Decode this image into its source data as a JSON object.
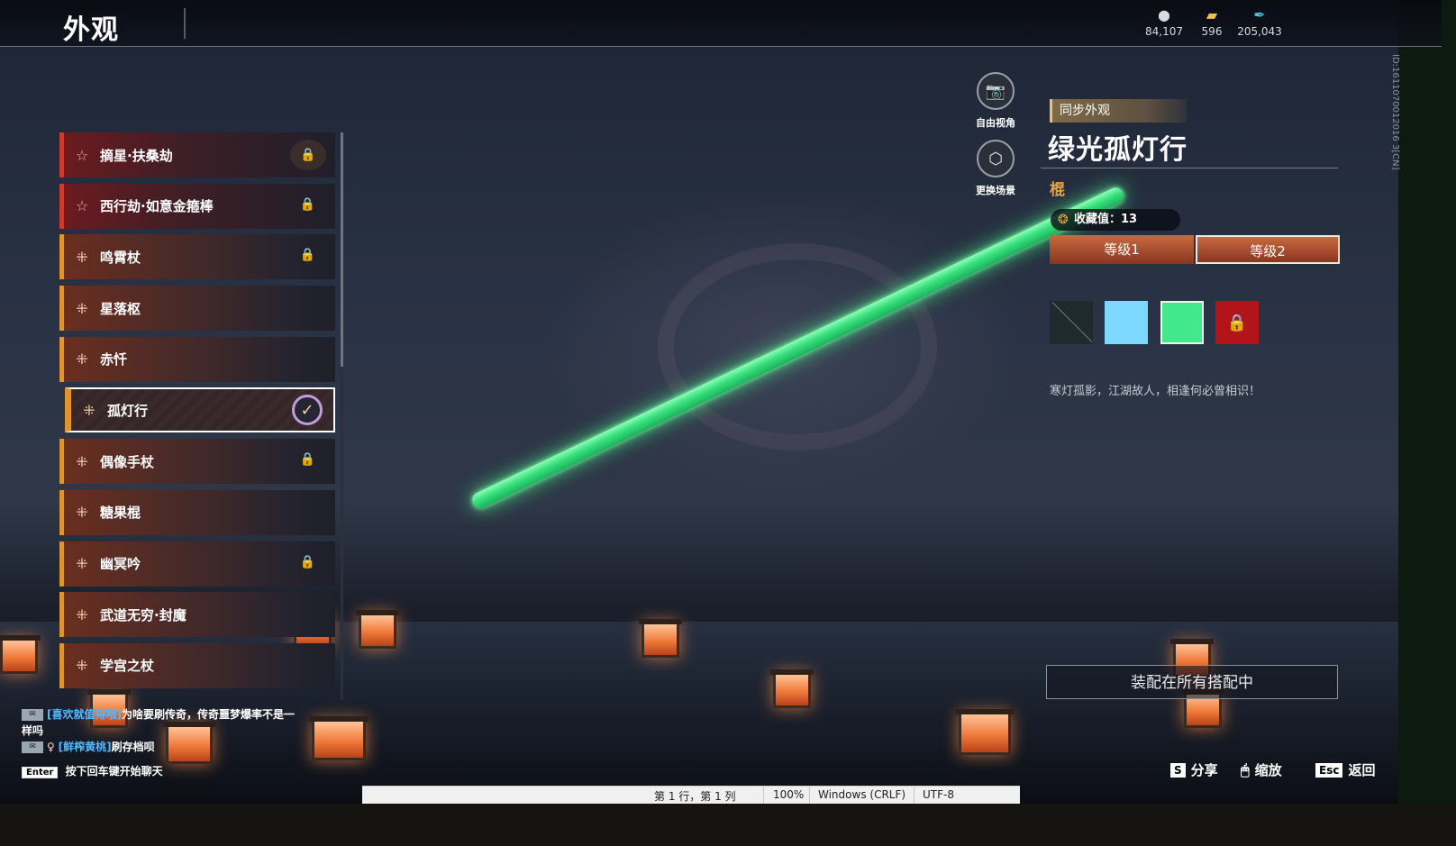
{
  "header": {
    "title": "外观",
    "currencies": [
      {
        "icon": "coin-icon",
        "value": "84,107"
      },
      {
        "icon": "ticket-icon",
        "value": "596"
      },
      {
        "icon": "feather-icon",
        "value": "205,043"
      }
    ]
  },
  "list": {
    "items": [
      {
        "label": "摘星·扶桑劫",
        "tier": "red",
        "locked": true
      },
      {
        "label": "西行劫·如意金箍棒",
        "tier": "red",
        "locked": true
      },
      {
        "label": "鸣霄杖",
        "tier": "orange",
        "locked": true
      },
      {
        "label": "星落枢",
        "tier": "orange",
        "locked": false
      },
      {
        "label": "赤忏",
        "tier": "orange",
        "locked": false
      },
      {
        "label": "孤灯行",
        "tier": "orange",
        "locked": false,
        "selected": true
      },
      {
        "label": "偶像手杖",
        "tier": "orange",
        "locked": true
      },
      {
        "label": "糖果棍",
        "tier": "orange",
        "locked": false
      },
      {
        "label": "幽冥吟",
        "tier": "orange",
        "locked": true
      },
      {
        "label": "武道无穷·封魔",
        "tier": "orange",
        "locked": false
      },
      {
        "label": "学宫之杖",
        "tier": "orange",
        "locked": false
      }
    ]
  },
  "camera": {
    "free_view": "自由视角",
    "change_scene": "更换场景"
  },
  "detail": {
    "sync_tag": "同步外观",
    "name": "绿光孤灯行",
    "type": "棍",
    "collection": "收藏值：13",
    "levels": [
      "等级1",
      "等级2"
    ],
    "active_level": 1,
    "swatches": [
      {
        "kind": "none",
        "color": "#1e2a2c"
      },
      {
        "kind": "color",
        "color": "#7fd8ff"
      },
      {
        "kind": "color",
        "color": "#41e88c"
      },
      {
        "kind": "locked",
        "color": "#b3141a"
      }
    ],
    "description": "寒灯孤影，江湖故人，相逢何必曾相识！",
    "equip_all": "装配在所有搭配中",
    "vertical_id": "ID:1611070012016 3[CN]"
  },
  "chat": {
    "lines": [
      {
        "user": "[喜欢就值得哦]",
        "text": "为啥要刷传奇，传奇噩梦爆率不是一样吗"
      },
      {
        "user": "[鲜榨黄桃]",
        "text": "刷存档呗"
      }
    ],
    "enter_key": "Enter",
    "enter_hint": "按下回车键开始聊天"
  },
  "hints": {
    "share_key": "S",
    "share": "分享",
    "zoom": "缩放",
    "back_key": "Esc",
    "back": "返回"
  },
  "statusbar": {
    "position": "第 1 行，第 1 列",
    "zoom": "100%",
    "line_ending": "Windows (CRLF)",
    "encoding": "UTF-8"
  }
}
